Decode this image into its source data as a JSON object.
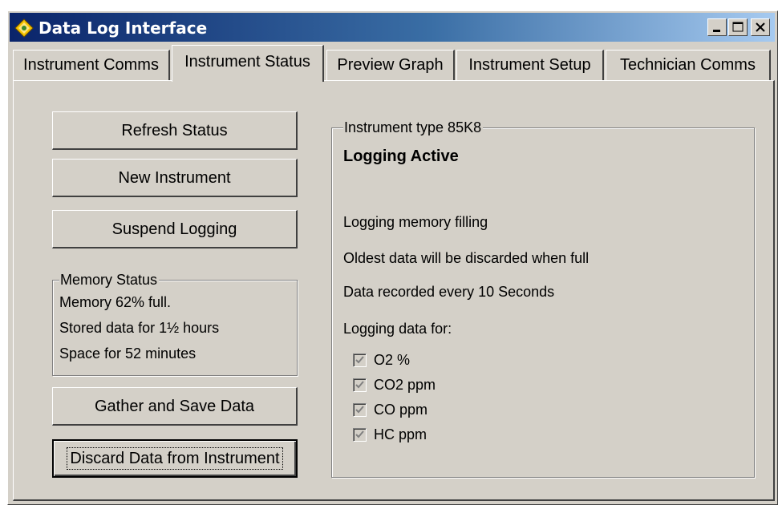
{
  "window": {
    "title": "Data Log Interface",
    "icon": "diamond-app-icon",
    "controls": [
      "minimize-icon",
      "maximize-icon",
      "close-icon"
    ]
  },
  "tabs": [
    {
      "label": "Instrument Comms",
      "active": false
    },
    {
      "label": "Instrument Status",
      "active": true
    },
    {
      "label": "Preview Graph",
      "active": false
    },
    {
      "label": "Instrument Setup",
      "active": false
    },
    {
      "label": "Technician Comms",
      "active": false
    }
  ],
  "buttons": {
    "refresh": "Refresh Status",
    "new_instrument": "New Instrument",
    "suspend": "Suspend Logging",
    "gather": "Gather and Save Data",
    "discard": "Discard Data from Instrument"
  },
  "memory_status": {
    "legend": "Memory Status",
    "lines": [
      "Memory 62% full.",
      "Stored data for 1½ hours",
      "Space for 52 minutes"
    ]
  },
  "instrument": {
    "legend": "Instrument type 85K8",
    "status": "Logging Active",
    "lines": [
      "Logging memory filling",
      "Oldest data will be discarded when full",
      "Data recorded every 10 Seconds"
    ],
    "logging_for_label": "Logging data for:",
    "channels": [
      {
        "label": "O2 %",
        "checked": true
      },
      {
        "label": "CO2 ppm",
        "checked": true
      },
      {
        "label": "CO ppm",
        "checked": true
      },
      {
        "label": "HC ppm",
        "checked": true
      }
    ]
  },
  "colors": {
    "face": "#d4d0c8",
    "title_start": "#0a246a",
    "title_end": "#a6caf0",
    "icon_yellow": "#f5c400"
  }
}
